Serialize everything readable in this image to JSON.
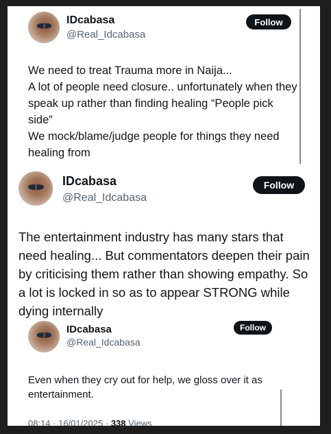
{
  "tweets": [
    {
      "name": "IDcabasa",
      "handle": "@Real_Idcabasa",
      "follow_label": "Follow",
      "text": "We need to treat Trauma more in Naija...\nA lot of people need closure.. unfortunately when they speak up rather than finding healing “People pick side”\nWe mock/blame/judge people for things they need healing from"
    },
    {
      "name": "IDcabasa",
      "handle": "@Real_Idcabasa",
      "follow_label": "Follow",
      "text": "The entertainment industry has many stars that need healing... But commentators deepen their pain by criticising them rather than showing empathy. So a lot is locked in so as to appear STRONG while dying internally"
    },
    {
      "name": "IDcabasa",
      "handle": "@Real_Idcabasa",
      "follow_label": "Follow",
      "text": "Even when they cry out for help, we gloss over it as entertainment.",
      "time": "08:14",
      "date": "16/01/2025",
      "separator": "·",
      "views_count": "338",
      "views_label": "Views"
    }
  ]
}
